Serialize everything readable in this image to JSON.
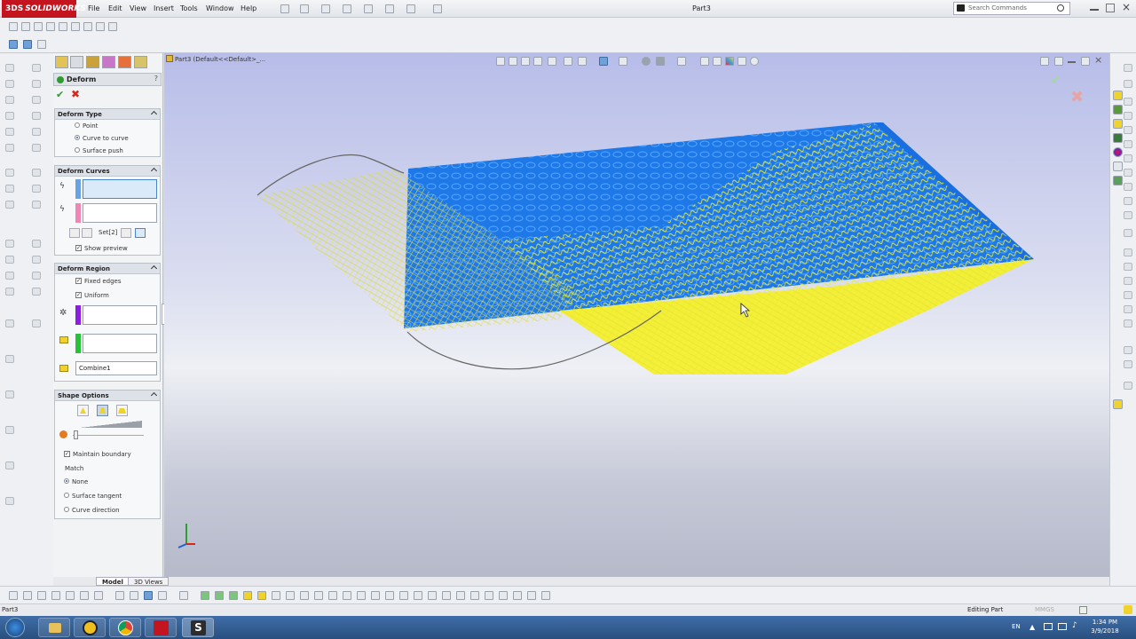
{
  "app": {
    "brand_prefix": "3DS",
    "brand": "SOLIDWORKS",
    "doc_title": "Part3"
  },
  "menu": [
    "File",
    "Edit",
    "View",
    "Insert",
    "Tools",
    "Window",
    "Help"
  ],
  "search": {
    "placeholder": "Search Commands"
  },
  "viewport": {
    "title": "Part3  (Default<<Default>_..."
  },
  "panel": {
    "title": "Deform",
    "deform_type": {
      "header": "Deform Type",
      "options": [
        "Point",
        "Curve to curve",
        "Surface push"
      ],
      "selected": "Curve to curve"
    },
    "deform_curves": {
      "header": "Deform Curves",
      "set_label": "Set[2]",
      "show_preview": "Show preview"
    },
    "deform_region": {
      "header": "Deform Region",
      "fixed_edges": "Fixed edges",
      "uniform": "Uniform",
      "body_value": "Combine1"
    },
    "shape_options": {
      "header": "Shape Options",
      "maintain_boundary": "Maintain boundary",
      "match_label": "Match",
      "match_options": [
        "None",
        "Surface tangent",
        "Curve direction"
      ],
      "match_selected": "None"
    }
  },
  "tabs": {
    "model": "Model",
    "views": "3D Views"
  },
  "status": {
    "left": "Part3",
    "mode": "Editing Part",
    "units": "MMGS"
  },
  "taskbar": {
    "lang": "EN",
    "time": "1:34 PM",
    "date": "3/9/2018"
  },
  "colors": {
    "accent_blue": "#1e78e8",
    "mesh_yellow": "#f4f027",
    "brand_red": "#c3141f",
    "ok_green": "#2f9a2f",
    "cancel_red": "#d42a1e"
  }
}
